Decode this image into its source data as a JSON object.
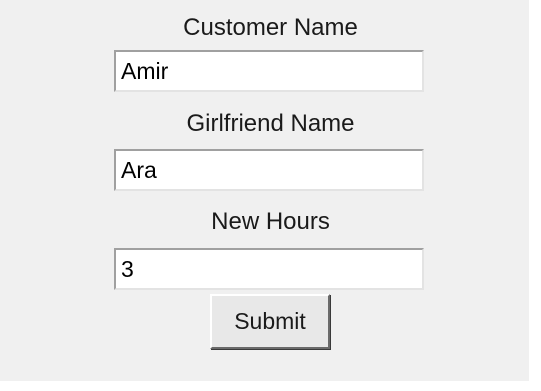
{
  "form": {
    "fields": [
      {
        "label": "Customer Name",
        "value": "Amir"
      },
      {
        "label": "Girlfriend Name",
        "value": "Ara"
      },
      {
        "label": "New Hours",
        "value": "3"
      }
    ],
    "submit_label": "Submit"
  }
}
